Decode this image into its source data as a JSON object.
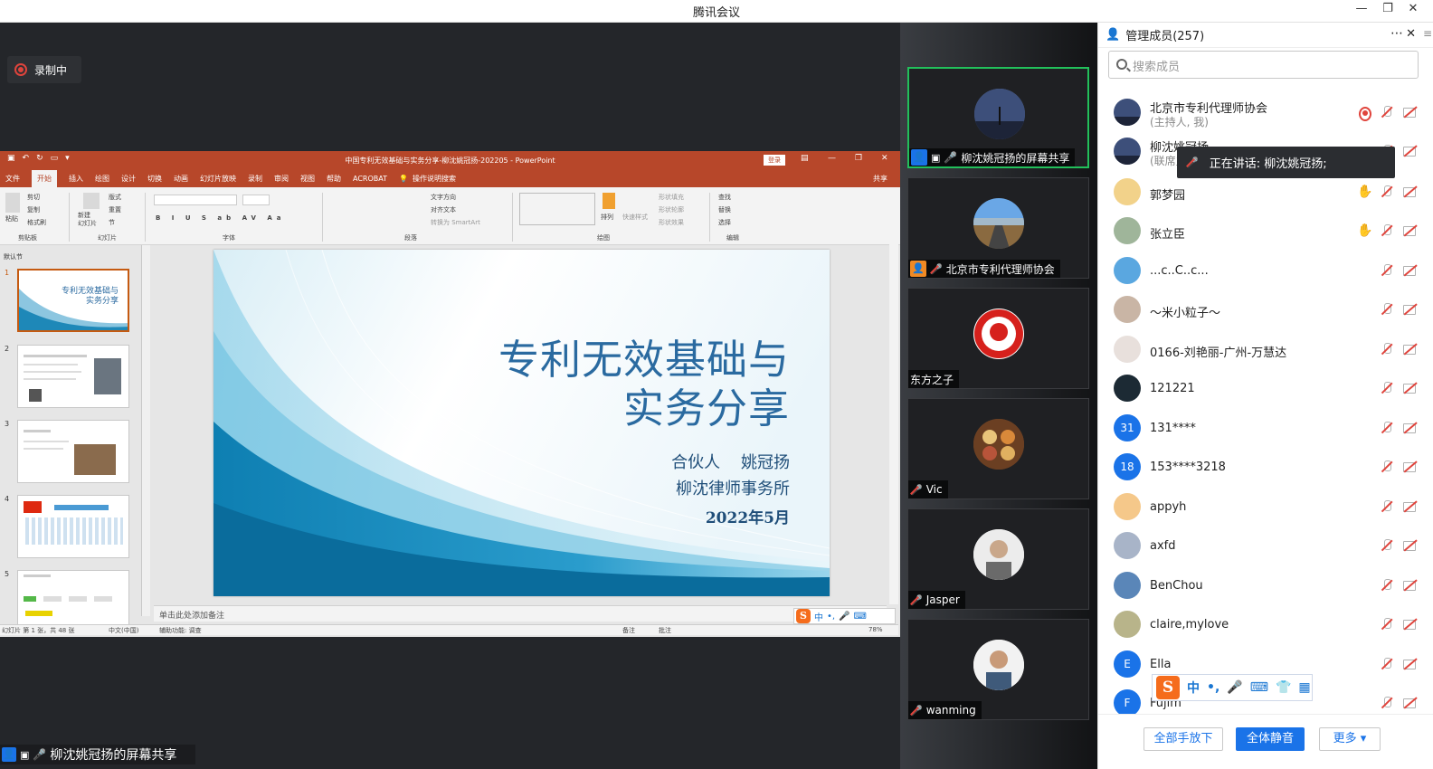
{
  "window": {
    "title": "腾讯会议",
    "min": "—",
    "max": "❐",
    "close": "✕"
  },
  "recording": {
    "label": "录制中"
  },
  "powerpoint": {
    "window_title": "中国专利无效基础与实务分享-柳沈姚冠扬-202205  -  PowerPoint",
    "login": "登录",
    "tabs": [
      "文件",
      "开始",
      "插入",
      "绘图",
      "设计",
      "切换",
      "动画",
      "幻灯片放映",
      "录制",
      "审阅",
      "视图",
      "帮助",
      "ACROBAT",
      "操作说明搜索"
    ],
    "share": "共享",
    "groups": [
      "剪贴板",
      "幻灯片",
      "字体",
      "段落",
      "绘图",
      "编辑"
    ],
    "ribbon_cmds": {
      "new_slide": "新建\n幻灯片",
      "paste": "粘贴",
      "cut": "剪切",
      "copy": "复制",
      "format_painter": "格式刷",
      "layout": "版式",
      "reset": "重置",
      "section": "节",
      "text_dir": "文字方向",
      "align_text": "对齐文本",
      "smartart": "转换为 SmartArt",
      "arrange": "排列",
      "quick_styles": "快速样式",
      "shape_fill": "形状填充",
      "shape_outline": "形状轮廓",
      "shape_effect": "形状效果",
      "find": "查找",
      "replace": "替换",
      "select": "选择"
    },
    "section_name": "默认节",
    "slide_numbers": [
      "1",
      "2",
      "3",
      "4",
      "5"
    ],
    "thumb_titles": [
      "专利无效基础与\n实务分享"
    ],
    "notes_placeholder": "单击此处添加备注",
    "status": {
      "slide_count": "幻灯片 第 1 张，共 48 张",
      "lang": "中文(中国)",
      "accessibility": "辅助功能: 调查",
      "notes_btn": "备注",
      "comments_btn": "批注",
      "zoom": "78%"
    }
  },
  "slide": {
    "title_line1": "专利无效基础与",
    "title_line2": "实务分享",
    "presenter": "合伙人    姚冠扬",
    "firm": "柳沈律师事务所",
    "date": "2022年5月"
  },
  "screen_share_label": "柳沈姚冠扬的屏幕共享",
  "gallery": [
    {
      "name": "柳沈姚冠扬的屏幕共享",
      "active": true
    },
    {
      "name": "北京市专利代理师协会",
      "active": false
    },
    {
      "name": "东方之子",
      "active": false
    },
    {
      "name": "Vic",
      "active": false
    },
    {
      "name": "Jasper",
      "active": false
    },
    {
      "name": "wanming",
      "active": false
    }
  ],
  "members_panel": {
    "title": "管理成员(257)",
    "search_placeholder": "搜索成员",
    "speaking_now": "正在讲话: 柳沈姚冠扬;",
    "members": [
      {
        "name": "北京市专利代理师协会",
        "sub": "(主持人, 我)",
        "status": "recording"
      },
      {
        "name": "柳沈姚冠扬",
        "sub": "(联席主持人)",
        "status": ""
      },
      {
        "name": "郭梦园",
        "sub": "",
        "status": "hand"
      },
      {
        "name": "张立臣",
        "sub": "",
        "status": "hand"
      },
      {
        "name": "...c..C..c...",
        "sub": "",
        "status": ""
      },
      {
        "name": "～米小粒子～",
        "sub": "",
        "status": ""
      },
      {
        "name": "0166-刘艳丽-广州-万慧达",
        "sub": "",
        "status": ""
      },
      {
        "name": "121221",
        "sub": "",
        "status": ""
      },
      {
        "name": "131****",
        "sub": "",
        "status": "",
        "initial": "31"
      },
      {
        "name": "153****3218",
        "sub": "",
        "status": "",
        "initial": "18"
      },
      {
        "name": "appyh",
        "sub": "",
        "status": ""
      },
      {
        "name": "axfd",
        "sub": "",
        "status": ""
      },
      {
        "name": "BenChou",
        "sub": "",
        "status": ""
      },
      {
        "name": "claire,mylove",
        "sub": "",
        "status": ""
      },
      {
        "name": "Ella",
        "sub": "",
        "status": "",
        "initial": "E"
      },
      {
        "name": "Fujim",
        "sub": "",
        "status": "",
        "initial": "F"
      }
    ],
    "buttons": {
      "lower_all_hands": "全部手放下",
      "mute_all": "全体静音",
      "more": "更多 ▾"
    }
  },
  "ime": {
    "logo": "S",
    "mode": "中",
    "punct": "•,",
    "icons": [
      "mic-icon",
      "keyboard-icon",
      "skin-icon",
      "toolbox-icon"
    ]
  },
  "colors": {
    "ppt_red": "#b7472a",
    "accent_blue": "#1a73e8",
    "active_green": "#22c05b"
  }
}
